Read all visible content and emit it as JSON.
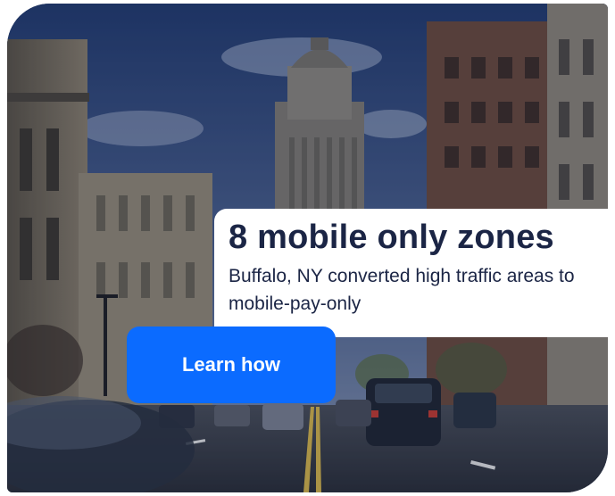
{
  "promo": {
    "headline": "8 mobile only zones",
    "description": "Buffalo, NY converted high traffic areas to mobile-pay-only",
    "cta_label": "Learn how"
  },
  "colors": {
    "headline_text": "#1b2545",
    "cta_background": "#0b6bff",
    "cta_text": "#ffffff",
    "card_background": "#ffffff"
  }
}
